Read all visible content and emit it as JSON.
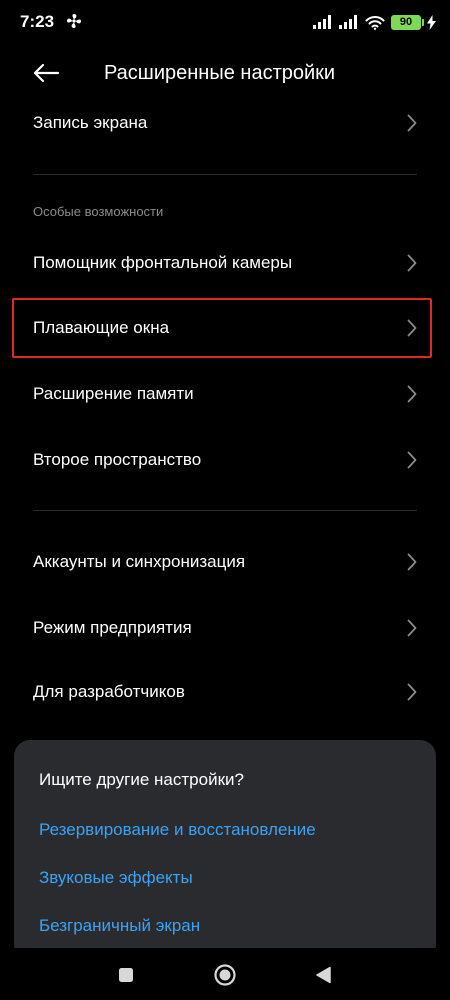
{
  "status_bar": {
    "time": "7:23",
    "battery": "90"
  },
  "header": {
    "title": "Расширенные настройки"
  },
  "rows_top": [
    {
      "label": "Запись экрана"
    }
  ],
  "section_accessibility": {
    "header": "Особые возможности",
    "items": [
      {
        "label": "Помощник фронтальной камеры"
      },
      {
        "label": "Плавающие окна"
      },
      {
        "label": "Расширение памяти"
      },
      {
        "label": "Второе пространство"
      }
    ]
  },
  "rows_bottom": [
    {
      "label": "Аккаунты и синхронизация"
    },
    {
      "label": "Режим предприятия"
    },
    {
      "label": "Для разработчиков"
    }
  ],
  "suggestions": {
    "title": "Ищите другие настройки?",
    "links": [
      {
        "label": "Резервирование и восстановление"
      },
      {
        "label": "Звуковые эффекты"
      },
      {
        "label": "Безграничный экран"
      }
    ]
  },
  "colors": {
    "accent": "#3ba3f5",
    "highlight": "#e02828",
    "battery": "#7ed957",
    "card": "#2a2b2e"
  },
  "icons": {
    "back": "arrow-left-icon",
    "chevron": "chevron-right-icon",
    "nav_recents": "square-icon",
    "nav_home": "circle-icon",
    "nav_back": "triangle-icon"
  }
}
